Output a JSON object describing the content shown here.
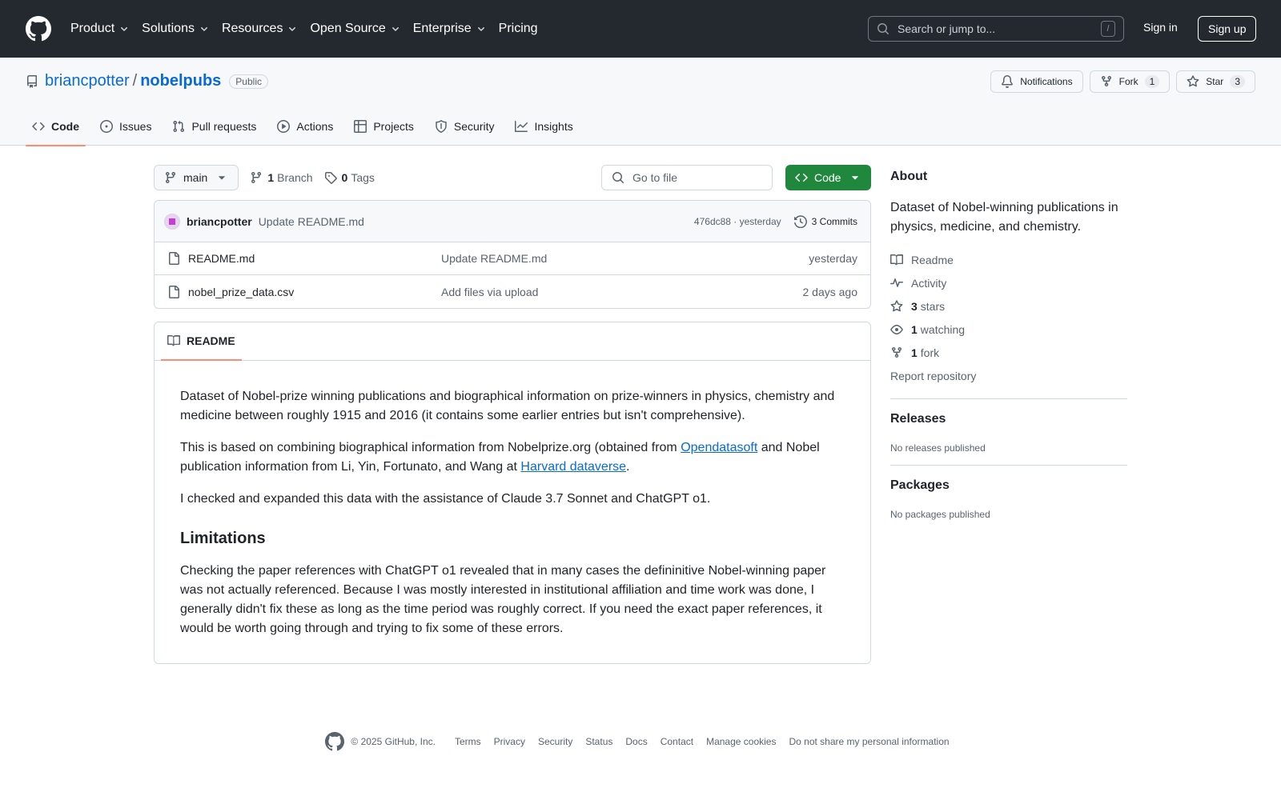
{
  "header": {
    "nav": [
      {
        "label": "Product",
        "dropdown": true
      },
      {
        "label": "Solutions",
        "dropdown": true
      },
      {
        "label": "Resources",
        "dropdown": true
      },
      {
        "label": "Open Source",
        "dropdown": true
      },
      {
        "label": "Enterprise",
        "dropdown": true
      },
      {
        "label": "Pricing",
        "dropdown": false
      }
    ],
    "search_placeholder": "Search or jump to...",
    "search_shortcut": "/",
    "signin": "Sign in",
    "signup": "Sign up"
  },
  "repo": {
    "owner": "briancpotter",
    "separator": "/",
    "name": "nobelpubs",
    "visibility": "Public",
    "notifications": "Notifications",
    "fork": {
      "label": "Fork",
      "count": "1"
    },
    "star": {
      "label": "Star",
      "count": "3"
    },
    "tabs": [
      {
        "label": "Code",
        "icon": "code-icon",
        "active": true
      },
      {
        "label": "Issues",
        "icon": "issue-icon"
      },
      {
        "label": "Pull requests",
        "icon": "pull-request-icon"
      },
      {
        "label": "Actions",
        "icon": "play-icon"
      },
      {
        "label": "Projects",
        "icon": "table-icon"
      },
      {
        "label": "Security",
        "icon": "shield-icon"
      },
      {
        "label": "Insights",
        "icon": "graph-icon"
      }
    ]
  },
  "toolbar": {
    "branch": "main",
    "branch_count": "1",
    "branch_label": "Branch",
    "tag_count": "0",
    "tag_label": "Tags",
    "goto_placeholder": "Go to file",
    "code_button": "Code"
  },
  "commit": {
    "author": "briancpotter",
    "message": "Update README.md",
    "hash_time": "476dc88 · yesterday",
    "commits": "3 Commits"
  },
  "files": [
    {
      "name": "README.md",
      "message": "Update README.md",
      "date": "yesterday"
    },
    {
      "name": "nobel_prize_data.csv",
      "message": "Add files via upload",
      "date": "2 days ago"
    }
  ],
  "readme": {
    "tab": "README",
    "p1": "Dataset of Nobel-prize winning publications and biographical information on prize-winners in physics, chemistry and medicine between roughly 1915 and 2016 (it contains some earlier entries but isn't comprehensive).",
    "p2_a": "This is based on combining biographical information from Nobelprize.org (obtained from ",
    "p2_link1": "Opendatasoft",
    "p2_b": " and Nobel publication information from Li, Yin, Fortunato, and Wang at ",
    "p2_link2": "Harvard dataverse",
    "p2_c": ".",
    "p3": "I checked and expanded this data with the assistance of Claude 3.7 Sonnet and ChatGPT o1.",
    "h2": "Limitations",
    "p4": "Checking the paper references with ChatGPT o1 revealed that in many cases the defininitive Nobel-winning paper was not actually referenced. Because I was mostly interested in institutional affiliation and time work was done, I generally didn't fix these as long as the time period was roughly correct. If you need the exact paper references, it would be worth going through and trying to fix some of these errors."
  },
  "about": {
    "title": "About",
    "description": "Dataset of Nobel-winning publications in physics, medicine, and chemistry.",
    "readme": "Readme",
    "activity": "Activity",
    "stars_count": "3",
    "stars_label": "stars",
    "watching_count": "1",
    "watching_label": "watching",
    "fork_count": "1",
    "fork_label": "fork",
    "report": "Report repository"
  },
  "releases": {
    "title": "Releases",
    "empty": "No releases published"
  },
  "packages": {
    "title": "Packages",
    "empty": "No packages published"
  },
  "footer": {
    "copyright": "© 2025 GitHub, Inc.",
    "links": [
      "Terms",
      "Privacy",
      "Security",
      "Status",
      "Docs",
      "Contact",
      "Manage cookies",
      "Do not share my personal information"
    ]
  },
  "colors": {
    "header_bg": "#24292f",
    "link": "#0969da",
    "code_button": "#1f883d",
    "active_tab_underline": "#fd8c73"
  }
}
